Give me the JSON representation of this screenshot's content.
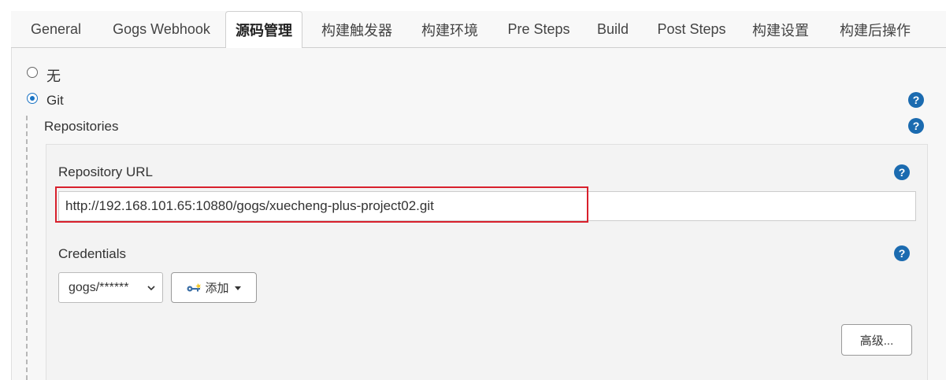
{
  "tabs": [
    {
      "label": "General",
      "active": false
    },
    {
      "label": "Gogs Webhook",
      "active": false
    },
    {
      "label": "源码管理",
      "active": true
    },
    {
      "label": "构建触发器",
      "active": false
    },
    {
      "label": "构建环境",
      "active": false
    },
    {
      "label": "Pre Steps",
      "active": false
    },
    {
      "label": "Build",
      "active": false
    },
    {
      "label": "Post Steps",
      "active": false
    },
    {
      "label": "构建设置",
      "active": false
    },
    {
      "label": "构建后操作",
      "active": false
    }
  ],
  "scm": {
    "option_none": "无",
    "option_git": "Git",
    "selected": "Git"
  },
  "repositories": {
    "label": "Repositories",
    "url_label": "Repository URL",
    "url_value": "http://192.168.101.65:10880/gogs/xuecheng-plus-project02.git",
    "credentials_label": "Credentials",
    "credentials_selected": "gogs/******",
    "add_button": "添加",
    "advanced_button": "高级..."
  },
  "help_glyph": "?",
  "colors": {
    "accent": "#1b74c4",
    "help": "#1b6bb0",
    "highlight": "#d8202c"
  }
}
